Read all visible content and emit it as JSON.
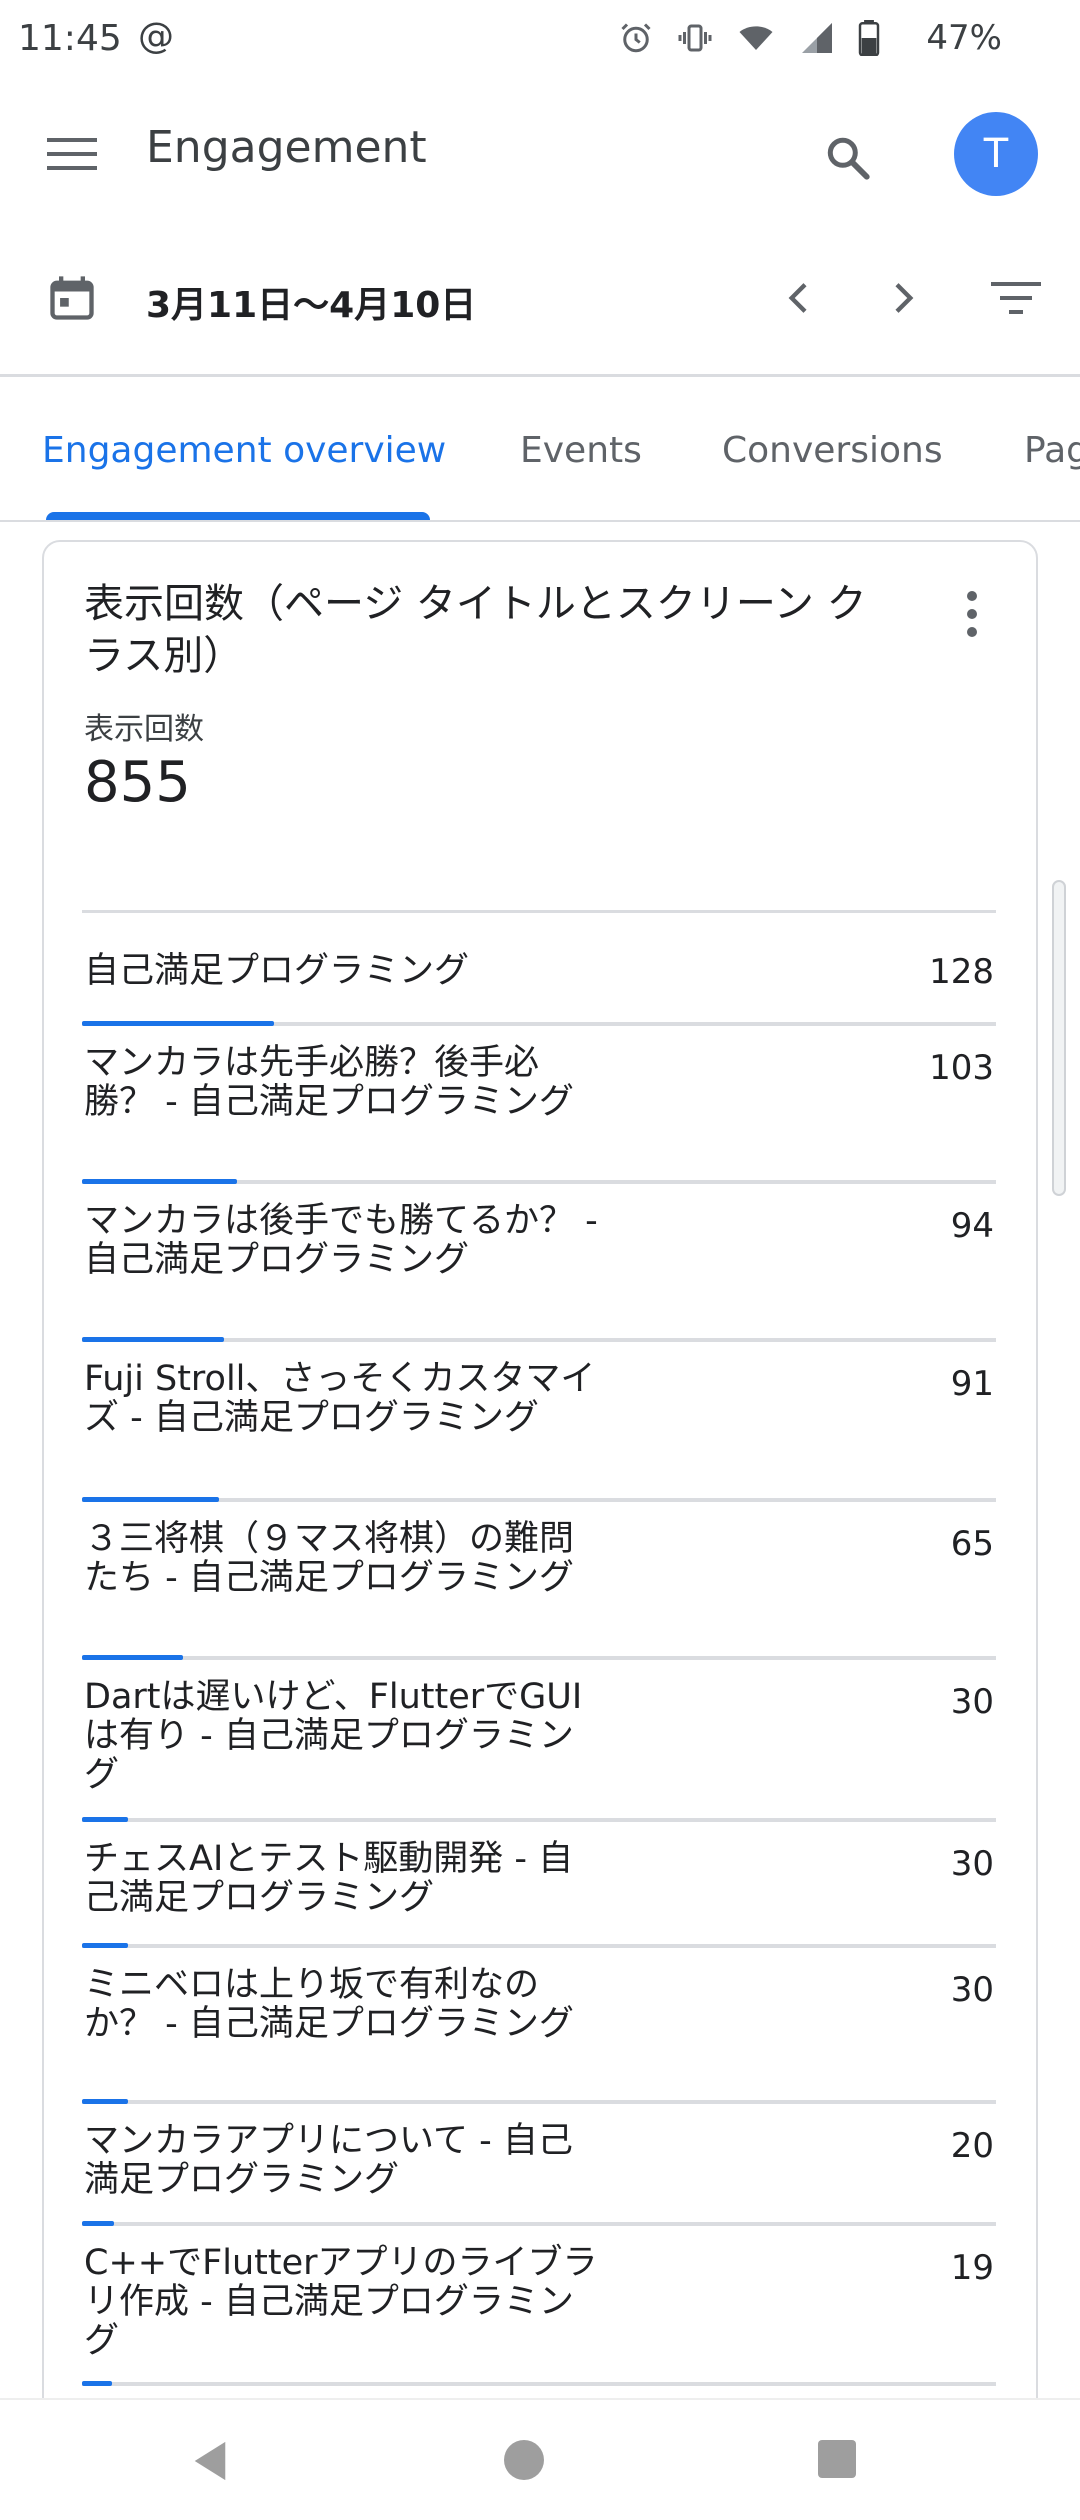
{
  "status_bar": {
    "time": "11:45",
    "at_symbol": "@",
    "battery_percent": "47%",
    "icons": [
      "alarm-icon",
      "vibrate-icon",
      "wifi-icon",
      "signal-icon",
      "battery-icon"
    ]
  },
  "app_bar": {
    "title": "Engagement",
    "avatar_letter": "T",
    "avatar_color": "#4285f4",
    "icons": [
      "menu-icon",
      "search-icon"
    ]
  },
  "date_bar": {
    "range": "3月11日〜4月10日",
    "icons": [
      "calendar-icon",
      "chevron-left-icon",
      "chevron-right-icon",
      "filter-icon"
    ]
  },
  "tabs": [
    {
      "label": "Engagement overview",
      "active": true
    },
    {
      "label": "Events",
      "active": false
    },
    {
      "label": "Conversions",
      "active": false
    },
    {
      "label": "Pag",
      "active": false
    }
  ],
  "accent_color": "#1a73e8",
  "card": {
    "title": "表示回数（ページ タイトルとスクリーン クラス別）",
    "metric_label": "表示回数",
    "metric_value": "855",
    "rows": [
      {
        "label": "自己満足プログラミング",
        "value": "128",
        "share": 0.21
      },
      {
        "label": "マンカラは先手必勝？後手必勝？ - 自己満足プログラミング",
        "value": "103",
        "share": 0.17
      },
      {
        "label": "マンカラは後手でも勝てるか？ - 自己満足プログラミング",
        "value": "94",
        "share": 0.155
      },
      {
        "label": "Fuji Stroll、さっそくカスタマイズ - 自己満足プログラミング",
        "value": "91",
        "share": 0.15
      },
      {
        "label": "３三将棋（９マス将棋）の難問たち - 自己満足プログラミング",
        "value": "65",
        "share": 0.11
      },
      {
        "label": "Dartは遅いけど、FlutterでGUIは有り - 自己満足プログラミング",
        "value": "30",
        "share": 0.05
      },
      {
        "label": "チェスAIとテスト駆動開発 - 自己満足プログラミング",
        "value": "30",
        "share": 0.05
      },
      {
        "label": "ミニベロは上り坂で有利なのか？ - 自己満足プログラミング",
        "value": "30",
        "share": 0.05
      },
      {
        "label": "マンカラアプリについて - 自己満足プログラミング",
        "value": "20",
        "share": 0.035
      },
      {
        "label": "C++でFlutterアプリのライブラリ作成 - 自己満足プログラミング",
        "value": "19",
        "share": 0.033
      }
    ]
  }
}
